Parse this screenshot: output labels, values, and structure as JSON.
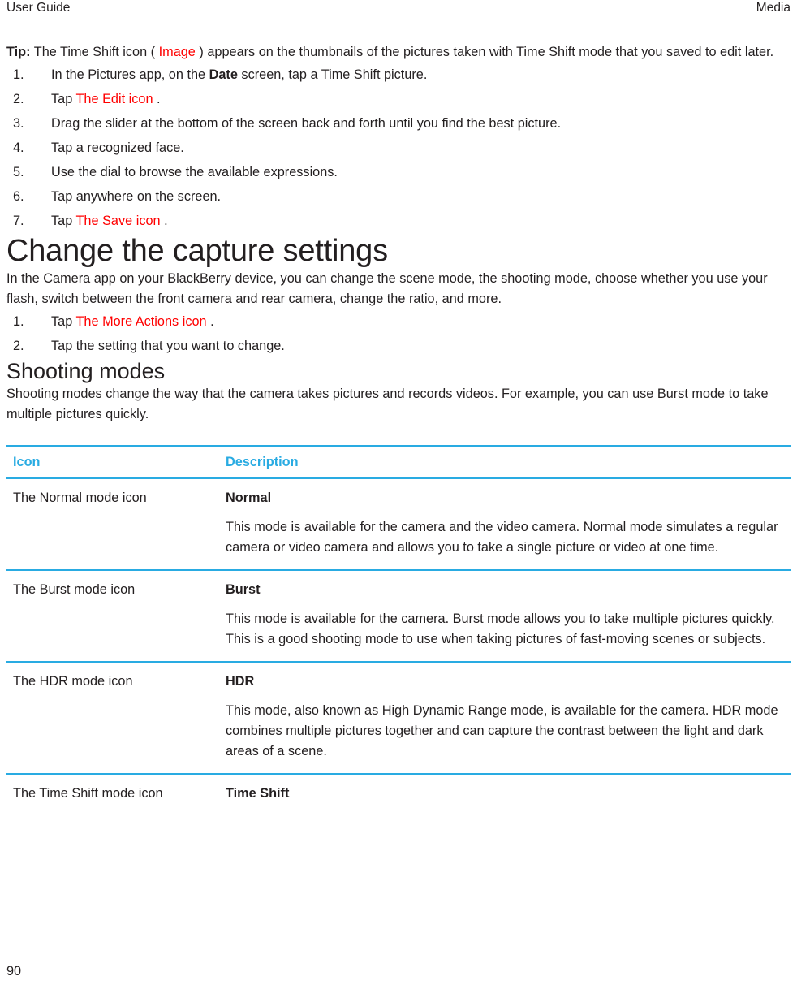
{
  "header": {
    "left": "User Guide",
    "right": "Media"
  },
  "tip": {
    "label": "Tip:",
    "before_link": " The Time Shift icon ( ",
    "link": "Image",
    "after_link": " ) appears on the thumbnails of the pictures taken with Time Shift mode that you saved to edit later."
  },
  "time_shift_steps": [
    {
      "num": "1.",
      "pre": "In the Pictures app, on the ",
      "bold": "Date",
      "post": " screen, tap a Time Shift picture.",
      "link": "",
      "tail": ""
    },
    {
      "num": "2.",
      "pre": "Tap ",
      "bold": "",
      "post": "",
      "link": "The Edit icon",
      "tail": " ."
    },
    {
      "num": "3.",
      "pre": "Drag the slider at the bottom of the screen back and forth until you find the best picture.",
      "bold": "",
      "post": "",
      "link": "",
      "tail": ""
    },
    {
      "num": "4.",
      "pre": "Tap a recognized face.",
      "bold": "",
      "post": "",
      "link": "",
      "tail": ""
    },
    {
      "num": "5.",
      "pre": "Use the dial to browse the available expressions.",
      "bold": "",
      "post": "",
      "link": "",
      "tail": ""
    },
    {
      "num": "6.",
      "pre": "Tap anywhere on the screen.",
      "bold": "",
      "post": "",
      "link": "",
      "tail": ""
    },
    {
      "num": "7.",
      "pre": "Tap ",
      "bold": "",
      "post": "",
      "link": "The Save icon",
      "tail": " ."
    }
  ],
  "capture_section": {
    "heading": "Change the capture settings",
    "intro": "In the Camera app on your BlackBerry device, you can change the scene mode, the shooting mode, choose whether you use your flash, switch between the front camera and rear camera, change the ratio, and more.",
    "steps": [
      {
        "num": "1.",
        "pre": "Tap ",
        "link": "The More Actions icon",
        "tail": " ."
      },
      {
        "num": "2.",
        "pre": "Tap the setting that you want to change.",
        "link": "",
        "tail": ""
      }
    ]
  },
  "shooting_section": {
    "heading": "Shooting modes",
    "intro": "Shooting modes change the way that the camera takes pictures and records videos. For example, you can use Burst mode to take multiple pictures quickly."
  },
  "table": {
    "columns": [
      "Icon",
      "Description"
    ],
    "rows": [
      {
        "icon": "The Normal mode icon",
        "title": "Normal",
        "description": "This mode is available for the camera and the video camera. Normal mode simulates a regular camera or video camera and allows you to take a single picture or video at one time."
      },
      {
        "icon": "The Burst mode icon",
        "title": "Burst",
        "description": "This mode is available for the camera. Burst mode allows you to take multiple pictures quickly. This is a good shooting mode to use when taking pictures of fast-moving scenes or subjects."
      },
      {
        "icon": "The HDR mode icon",
        "title": "HDR",
        "description": "This mode, also known as High Dynamic Range mode, is available for the camera. HDR mode combines multiple pictures together and can capture the contrast between the light and dark areas of a scene."
      },
      {
        "icon": "The Time Shift mode icon",
        "title": "Time Shift",
        "description": ""
      }
    ]
  },
  "footer": {
    "page_number": "90"
  },
  "colors": {
    "link_red": "#ff0000",
    "accent_blue": "#29abe2",
    "text": "#231f20"
  }
}
